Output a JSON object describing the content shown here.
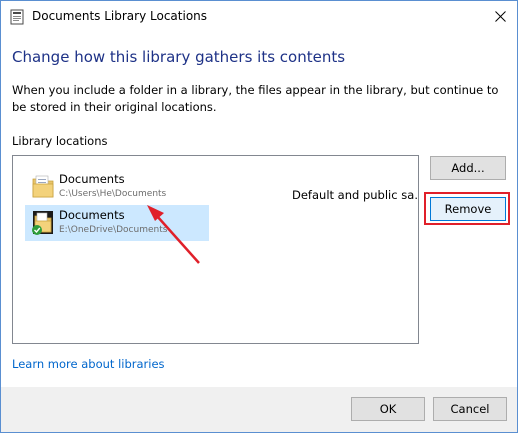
{
  "window": {
    "title": "Documents Library Locations",
    "close_icon": "close-icon"
  },
  "content": {
    "heading": "Change how this library gathers its contents",
    "description": "When you include a folder in a library, the files appear in the library, but continue to be stored in their original locations.",
    "section_label": "Library locations"
  },
  "locations": [
    {
      "name": "Documents",
      "path": "C:\\Users\\He\\Documents",
      "status": "Default and public sav...",
      "icon": "folder-icon",
      "selected": false
    },
    {
      "name": "Documents",
      "path": "E:\\OneDrive\\Documents",
      "status": "",
      "icon": "onedrive-folder-icon",
      "selected": true
    }
  ],
  "buttons": {
    "add": "Add...",
    "remove": "Remove",
    "ok": "OK",
    "cancel": "Cancel"
  },
  "link": {
    "learn_more": "Learn more about libraries"
  },
  "colors": {
    "heading": "#1e3287",
    "link": "#0066cc",
    "selection": "#cce8ff",
    "annotation": "#e0202a",
    "focus_border": "#0078d7"
  }
}
